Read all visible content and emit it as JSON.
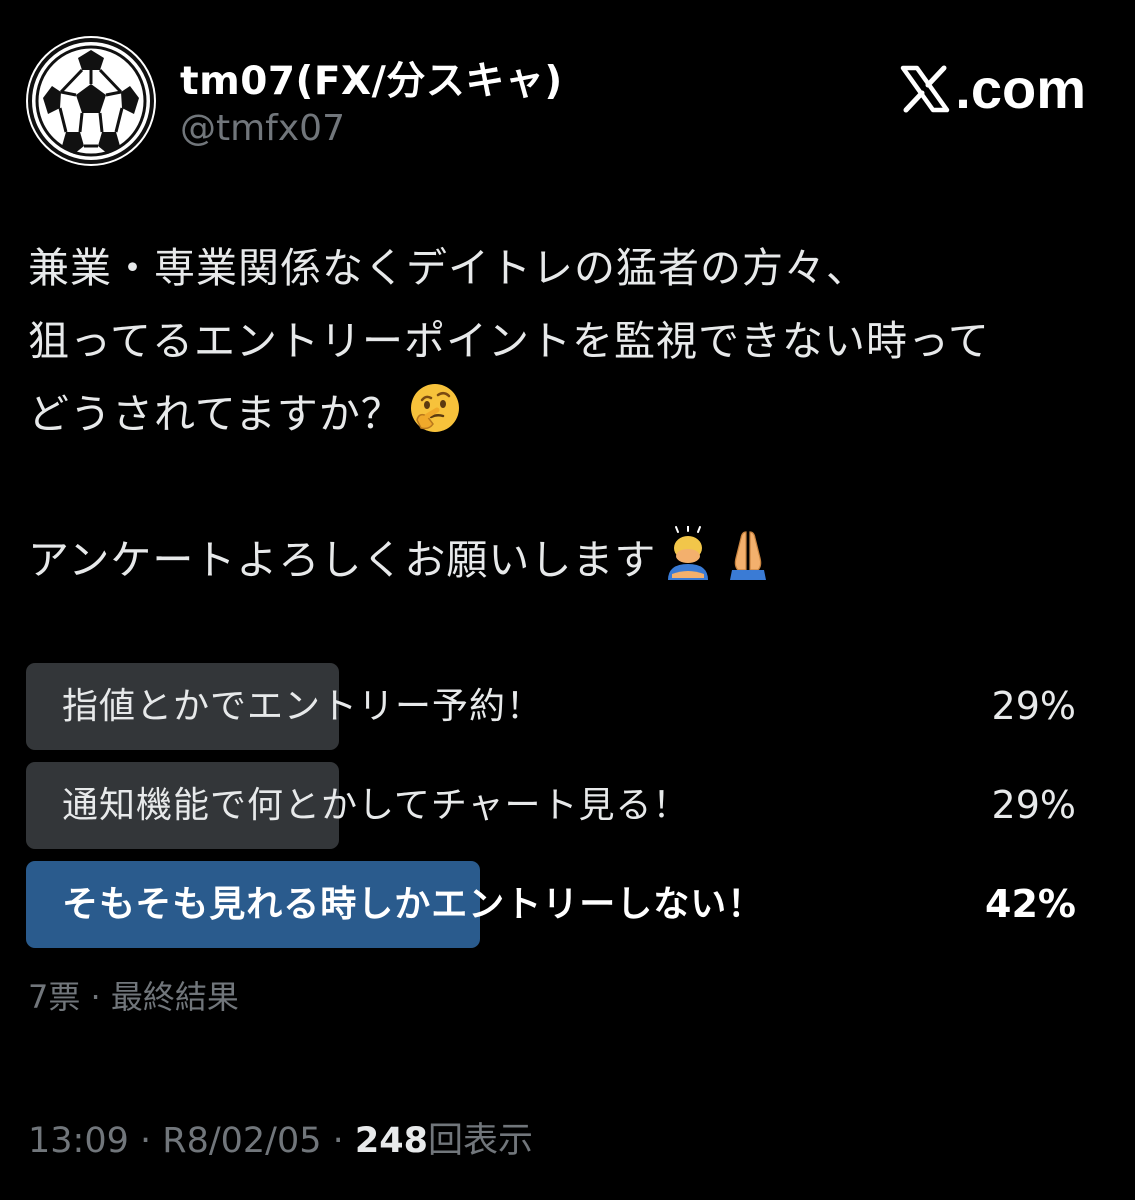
{
  "author": {
    "display_name": "tm07(FX/分スキャ)",
    "handle": "@tmfx07",
    "avatar_icon": "soccer-ball-icon"
  },
  "brand": {
    "logo_icon": "x-logo-icon",
    "suffix": ".com"
  },
  "tweet": {
    "lines": [
      "兼業・専業関係なくデイトレの猛者の方々、",
      "狙ってるエントリーポイントを監視できない時って",
      "どうされてますか？",
      "",
      "アンケートよろしくお願いします"
    ],
    "emojis": [
      "thinking-face-emoji",
      "bowing-person-emoji",
      "folded-hands-emoji"
    ]
  },
  "poll": {
    "options": [
      {
        "label": "指値とかでエントリー予約！",
        "percent_text": "29%",
        "percent": 29,
        "winner": false
      },
      {
        "label": "通知機能で何とかしてチャート見る！",
        "percent_text": "29%",
        "percent": 29,
        "winner": false
      },
      {
        "label": "そもそも見れる時しかエントリーしない！",
        "percent_text": "42%",
        "percent": 42,
        "winner": true
      }
    ],
    "meta": "7票 · 最終結果",
    "colors": {
      "bar": "#333639",
      "winner_bar": "#2a5b8d"
    }
  },
  "footer": {
    "time": "13:09",
    "date": "R8/02/05",
    "views": "248",
    "views_label": "回表示",
    "separator": " · "
  }
}
